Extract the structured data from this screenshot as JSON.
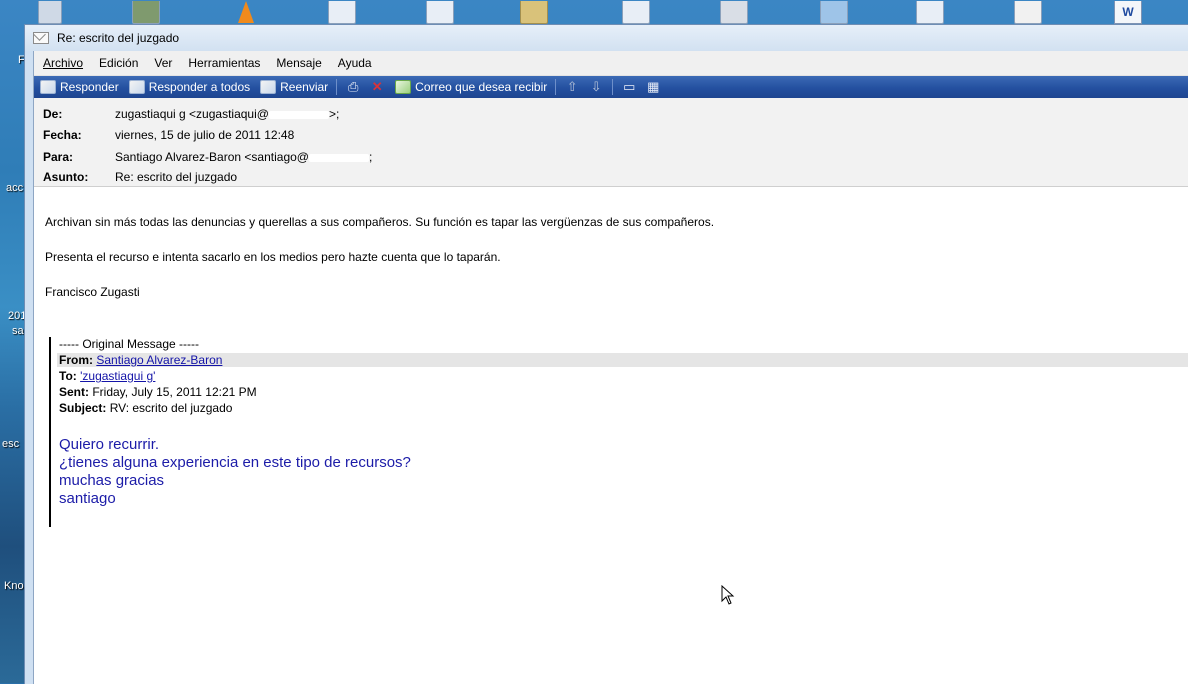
{
  "desktop": {
    "labels": [
      "F",
      "acc",
      "201",
      "sa",
      "esc",
      "Kno"
    ]
  },
  "window": {
    "title": "Re: escrito del juzgado"
  },
  "menu": [
    "Archivo",
    "Edición",
    "Ver",
    "Herramientas",
    "Mensaje",
    "Ayuda"
  ],
  "toolbar": {
    "reply": "Responder",
    "reply_all": "Responder a todos",
    "forward": "Reenviar",
    "receipt": "Correo que desea recibir"
  },
  "headers": {
    "from_label": "De:",
    "from_value": "zugastiaqui g <zugastiaqui@",
    "from_tail": ">;",
    "date_label": "Fecha:",
    "date_value": "viernes, 15 de julio de 2011 12:48",
    "to_label": "Para:",
    "to_value": "Santiago Alvarez-Baron <santiago@",
    "to_tail": ";",
    "subject_label": "Asunto:",
    "subject_value": "Re: escrito del juzgado"
  },
  "body": {
    "line1": "Archivan sin más todas las denuncias y querellas a sus compañeros. Su función es tapar las vergüenzas de sus compañeros.",
    "line2": "Presenta el recurso e intenta sacarlo en los medios pero hazte cuenta que lo taparán.",
    "signature": "Francisco Zugasti"
  },
  "original": {
    "marker": "----- Original Message -----",
    "from_label": "From:",
    "from_value": "Santiago Alvarez-Baron",
    "to_label": "To:",
    "to_value": "'zugastiagui g'",
    "sent_label": "Sent:",
    "sent_value": "Friday, July 15, 2011 12:21 PM",
    "subject_label": "Subject:",
    "subject_value": "RV: escrito del juzgado",
    "lines": [
      "Quiero recurrir.",
      "¿tienes alguna experiencia en este tipo de recursos?",
      "muchas gracias",
      "santiago"
    ]
  }
}
